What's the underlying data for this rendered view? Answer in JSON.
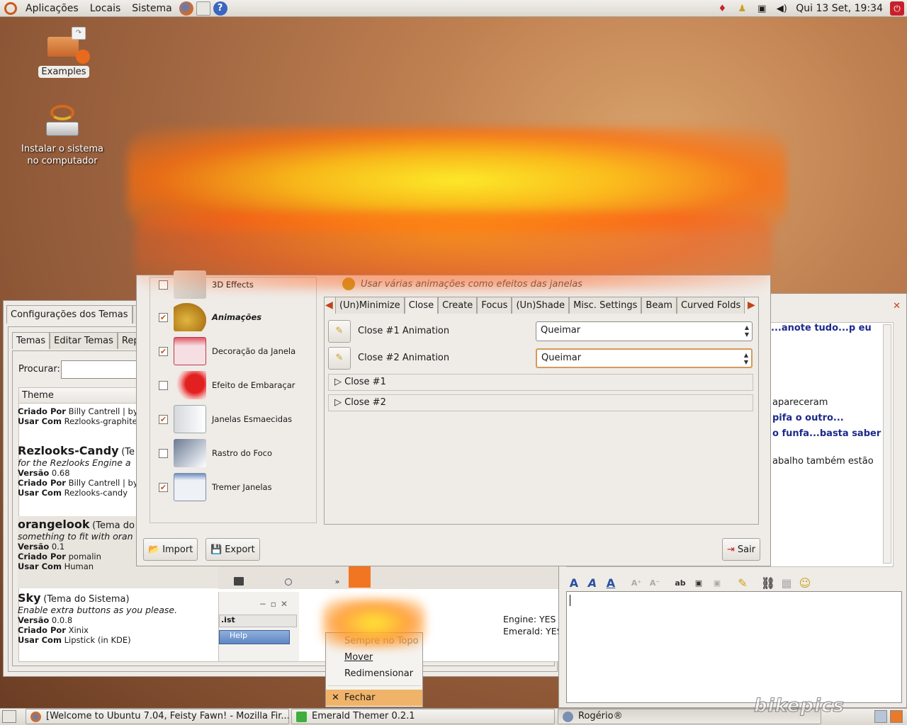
{
  "top_panel": {
    "menus": [
      "Aplicações",
      "Locais",
      "Sistema"
    ],
    "clock": "Qui 13 Set, 19:34",
    "launchers": [
      "firefox-icon",
      "mail-icon",
      "help-icon"
    ]
  },
  "desktop": {
    "icons": [
      {
        "label": "Examples"
      },
      {
        "label": "Instalar o sistema no computador"
      }
    ]
  },
  "emerald": {
    "outer_tab": "Configurações dos Temas",
    "outer_tab2": "C",
    "inner_tabs": [
      "Temas",
      "Editar Temas",
      "Repo"
    ],
    "search_label": "Procurar:",
    "search_value": "",
    "column_header": "Theme",
    "themes": [
      {
        "created_by_label": "Criado Por",
        "created_by": "Billy Cantrell | by",
        "use_with_label": "Usar Com",
        "use_with": "Rezlooks-graphite"
      },
      {
        "name": "Rezlooks-Candy",
        "name_suffix": "(Te",
        "desc": "for the Rezlooks Engine a",
        "version_label": "Versão",
        "version": "0.68",
        "created_by_label": "Criado Por",
        "created_by": "Billy Cantrell | by",
        "use_with_label": "Usar Com",
        "use_with": "Rezlooks-candy"
      },
      {
        "name": "orangelook",
        "name_suffix": "(Tema do",
        "desc": "something to fit with oran",
        "version_label": "Versão",
        "version": "0.1",
        "created_by_label": "Criado Por",
        "created_by": "pomalin",
        "use_with_label": "Usar Com",
        "use_with": "Human"
      },
      {
        "name": "Sky",
        "name_suffix": "(Tema do Sistema)",
        "desc": "Enable extra buttons as you please.",
        "version_label": "Versão",
        "version": "0.0.8",
        "created_by_label": "Criado Por",
        "created_by": "Xinix",
        "use_with_label": "Usar Com",
        "use_with": "Lipstick (in KDE)"
      }
    ],
    "preview_labels": {
      "list": ".ist",
      "help": "Help"
    },
    "engine_lines": [
      "Engine: YES",
      "Emerald: YES"
    ]
  },
  "ccsm": {
    "plugins": [
      {
        "name": "3D Effects",
        "checked": false
      },
      {
        "name": "Animações",
        "checked": true,
        "bold": true
      },
      {
        "name": "Decoração da Janela",
        "checked": true
      },
      {
        "name": "Efeito de Embaraçar",
        "checked": false
      },
      {
        "name": "Janelas Esmaecidas",
        "checked": true
      },
      {
        "name": "Rastro do Foco",
        "checked": false
      },
      {
        "name": "Tremer Janelas",
        "checked": true
      }
    ],
    "description": "Usar várias animações como efeitos das janelas",
    "tabs": [
      "(Un)Minimize",
      "Close",
      "Create",
      "Focus",
      "(Un)Shade",
      "Misc. Settings",
      "Beam",
      "Curved Folds"
    ],
    "active_tab": "Close",
    "settings": [
      {
        "label": "Close #1 Animation",
        "value": "Queimar"
      },
      {
        "label": "Close #2 Animation",
        "value": "Queimar"
      }
    ],
    "expanders": [
      "Close #1",
      "Close #2"
    ],
    "buttons": {
      "import": "Import",
      "export": "Export",
      "quit": "Sair"
    }
  },
  "context_menu": {
    "items": [
      "Sempre no Topo",
      "Mover",
      "Redimensionar",
      "Fechar"
    ],
    "highlighted": "Fechar"
  },
  "chat": {
    "messages": [
      "...anote tudo...p eu",
      "apareceram",
      "pifa o outro...",
      "o funfa...basta saber",
      "abalho também estão"
    ],
    "input_value": ""
  },
  "taskbar": {
    "items": [
      {
        "label": "[Welcome to Ubuntu 7.04, Feisty Fawn! - Mozilla Fir..."
      },
      {
        "label": "Emerald Themer 0.2.1"
      },
      {
        "label": "Rogério®"
      }
    ]
  },
  "watermark": "bikepics",
  "colors": {
    "accent": "#d86a1e",
    "panel": "#dcd8d0",
    "link_blue": "#1d2a8a"
  }
}
